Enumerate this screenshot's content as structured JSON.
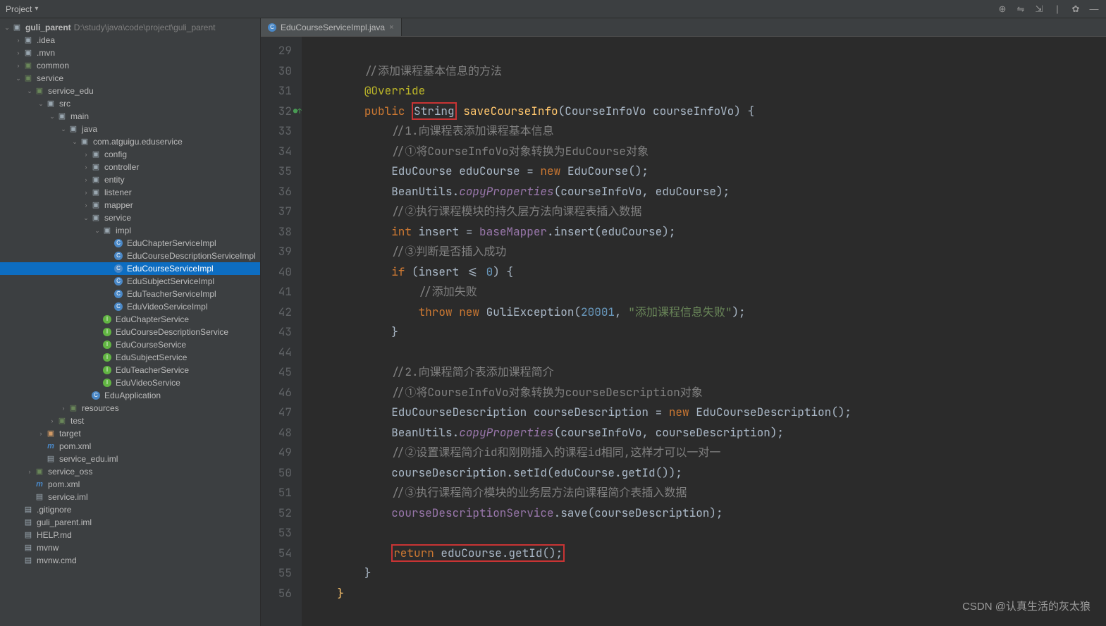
{
  "toolbar": {
    "project_label": "Project",
    "dropdown": "▾"
  },
  "project": {
    "root_name": "guli_parent",
    "root_path": "D:\\study\\java\\code\\project\\guli_parent",
    "tree": [
      {
        "label": ".idea",
        "indent": 1,
        "arrow": "closed",
        "icon": "folder"
      },
      {
        "label": ".mvn",
        "indent": 1,
        "arrow": "closed",
        "icon": "folder"
      },
      {
        "label": "common",
        "indent": 1,
        "arrow": "closed",
        "icon": "folder-green"
      },
      {
        "label": "service",
        "indent": 1,
        "arrow": "open",
        "icon": "folder-green"
      },
      {
        "label": "service_edu",
        "indent": 2,
        "arrow": "open",
        "icon": "folder-green"
      },
      {
        "label": "src",
        "indent": 3,
        "arrow": "open",
        "icon": "folder"
      },
      {
        "label": "main",
        "indent": 4,
        "arrow": "open",
        "icon": "folder"
      },
      {
        "label": "java",
        "indent": 5,
        "arrow": "open",
        "icon": "folder"
      },
      {
        "label": "com.atguigu.eduservice",
        "indent": 6,
        "arrow": "open",
        "icon": "folder"
      },
      {
        "label": "config",
        "indent": 7,
        "arrow": "closed",
        "icon": "folder"
      },
      {
        "label": "controller",
        "indent": 7,
        "arrow": "closed",
        "icon": "folder"
      },
      {
        "label": "entity",
        "indent": 7,
        "arrow": "closed",
        "icon": "folder"
      },
      {
        "label": "listener",
        "indent": 7,
        "arrow": "closed",
        "icon": "folder"
      },
      {
        "label": "mapper",
        "indent": 7,
        "arrow": "closed",
        "icon": "folder"
      },
      {
        "label": "service",
        "indent": 7,
        "arrow": "open",
        "icon": "folder"
      },
      {
        "label": "impl",
        "indent": 8,
        "arrow": "open",
        "icon": "folder"
      },
      {
        "label": "EduChapterServiceImpl",
        "indent": 9,
        "arrow": "none",
        "icon": "class"
      },
      {
        "label": "EduCourseDescriptionServiceImpl",
        "indent": 9,
        "arrow": "none",
        "icon": "class"
      },
      {
        "label": "EduCourseServiceImpl",
        "indent": 9,
        "arrow": "none",
        "icon": "class",
        "selected": true
      },
      {
        "label": "EduSubjectServiceImpl",
        "indent": 9,
        "arrow": "none",
        "icon": "class"
      },
      {
        "label": "EduTeacherServiceImpl",
        "indent": 9,
        "arrow": "none",
        "icon": "class"
      },
      {
        "label": "EduVideoServiceImpl",
        "indent": 9,
        "arrow": "none",
        "icon": "class"
      },
      {
        "label": "EduChapterService",
        "indent": 8,
        "arrow": "none",
        "icon": "interface"
      },
      {
        "label": "EduCourseDescriptionService",
        "indent": 8,
        "arrow": "none",
        "icon": "interface"
      },
      {
        "label": "EduCourseService",
        "indent": 8,
        "arrow": "none",
        "icon": "interface"
      },
      {
        "label": "EduSubjectService",
        "indent": 8,
        "arrow": "none",
        "icon": "interface"
      },
      {
        "label": "EduTeacherService",
        "indent": 8,
        "arrow": "none",
        "icon": "interface"
      },
      {
        "label": "EduVideoService",
        "indent": 8,
        "arrow": "none",
        "icon": "interface"
      },
      {
        "label": "EduApplication",
        "indent": 7,
        "arrow": "none",
        "icon": "class"
      },
      {
        "label": "resources",
        "indent": 5,
        "arrow": "closed",
        "icon": "folder-green"
      },
      {
        "label": "test",
        "indent": 4,
        "arrow": "closed",
        "icon": "folder-green"
      },
      {
        "label": "target",
        "indent": 3,
        "arrow": "closed",
        "icon": "folder-orange"
      },
      {
        "label": "pom.xml",
        "indent": 3,
        "arrow": "none",
        "icon": "maven"
      },
      {
        "label": "service_edu.iml",
        "indent": 3,
        "arrow": "none",
        "icon": "file"
      },
      {
        "label": "service_oss",
        "indent": 2,
        "arrow": "closed",
        "icon": "folder-green"
      },
      {
        "label": "pom.xml",
        "indent": 2,
        "arrow": "none",
        "icon": "maven"
      },
      {
        "label": "service.iml",
        "indent": 2,
        "arrow": "none",
        "icon": "file"
      },
      {
        "label": ".gitignore",
        "indent": 1,
        "arrow": "none",
        "icon": "file"
      },
      {
        "label": "guli_parent.iml",
        "indent": 1,
        "arrow": "none",
        "icon": "file"
      },
      {
        "label": "HELP.md",
        "indent": 1,
        "arrow": "none",
        "icon": "file"
      },
      {
        "label": "mvnw",
        "indent": 1,
        "arrow": "none",
        "icon": "file"
      },
      {
        "label": "mvnw.cmd",
        "indent": 1,
        "arrow": "none",
        "icon": "file"
      }
    ]
  },
  "tabs": {
    "current": "EduCourseServiceImpl.java"
  },
  "code": {
    "lines": [
      {
        "n": 29,
        "t": []
      },
      {
        "n": 30,
        "t": [
          {
            "s": "        "
          },
          {
            "c": "c-comment",
            "s": "//添加课程基本信息的方法"
          }
        ]
      },
      {
        "n": 31,
        "t": [
          {
            "s": "        "
          },
          {
            "c": "c-annotation",
            "s": "@Override"
          }
        ]
      },
      {
        "n": 32,
        "marker": true,
        "t": [
          {
            "s": "        "
          },
          {
            "c": "c-keyword",
            "s": "public"
          },
          {
            "s": " "
          },
          {
            "c": "c-identifier highlight-red",
            "s": "String"
          },
          {
            "s": " "
          },
          {
            "c": "c-method",
            "s": "saveCourseInfo"
          },
          {
            "c": "c-identifier",
            "s": "(CourseInfoVo courseInfoVo) {"
          }
        ]
      },
      {
        "n": 33,
        "t": [
          {
            "s": "            "
          },
          {
            "c": "c-comment",
            "s": "//1.向课程表添加课程基本信息"
          }
        ]
      },
      {
        "n": 34,
        "t": [
          {
            "s": "            "
          },
          {
            "c": "c-comment",
            "s": "//①将CourseInfoVo对象转换为EduCourse对象"
          }
        ]
      },
      {
        "n": 35,
        "t": [
          {
            "s": "            "
          },
          {
            "c": "c-identifier",
            "s": "EduCourse eduCourse = "
          },
          {
            "c": "c-keyword",
            "s": "new"
          },
          {
            "c": "c-identifier",
            "s": " EduCourse();"
          }
        ]
      },
      {
        "n": 36,
        "t": [
          {
            "s": "            "
          },
          {
            "c": "c-identifier",
            "s": "BeanUtils."
          },
          {
            "c": "c-italic",
            "s": "copyProperties"
          },
          {
            "c": "c-identifier",
            "s": "(courseInfoVo, eduCourse);"
          }
        ]
      },
      {
        "n": 37,
        "t": [
          {
            "s": "            "
          },
          {
            "c": "c-comment",
            "s": "//②执行课程模块的持久层方法向课程表插入数据"
          }
        ]
      },
      {
        "n": 38,
        "t": [
          {
            "s": "            "
          },
          {
            "c": "c-keyword",
            "s": "int"
          },
          {
            "c": "c-identifier",
            "s": " insert = "
          },
          {
            "c": "c-purple",
            "s": "baseMapper"
          },
          {
            "c": "c-identifier",
            "s": ".insert(eduCourse);"
          }
        ]
      },
      {
        "n": 39,
        "t": [
          {
            "s": "            "
          },
          {
            "c": "c-comment",
            "s": "//③判断是否插入成功"
          }
        ]
      },
      {
        "n": 40,
        "t": [
          {
            "s": "            "
          },
          {
            "c": "c-keyword",
            "s": "if"
          },
          {
            "c": "c-identifier",
            "s": " (insert <= "
          },
          {
            "c": "c-number",
            "s": "0"
          },
          {
            "c": "c-identifier",
            "s": ") {"
          }
        ]
      },
      {
        "n": 41,
        "t": [
          {
            "s": "                "
          },
          {
            "c": "c-comment",
            "s": "//添加失败"
          }
        ]
      },
      {
        "n": 42,
        "t": [
          {
            "s": "                "
          },
          {
            "c": "c-keyword",
            "s": "throw new"
          },
          {
            "c": "c-identifier",
            "s": " GuliException("
          },
          {
            "c": "c-number",
            "s": "20001"
          },
          {
            "c": "c-identifier",
            "s": ", "
          },
          {
            "c": "c-str",
            "s": "\"添加课程信息失败\""
          },
          {
            "c": "c-identifier",
            "s": ");"
          }
        ]
      },
      {
        "n": 43,
        "t": [
          {
            "s": "            "
          },
          {
            "c": "c-identifier",
            "s": "}"
          }
        ]
      },
      {
        "n": 44,
        "t": []
      },
      {
        "n": 45,
        "t": [
          {
            "s": "            "
          },
          {
            "c": "c-comment",
            "s": "//2.向课程简介表添加课程简介"
          }
        ]
      },
      {
        "n": 46,
        "t": [
          {
            "s": "            "
          },
          {
            "c": "c-comment",
            "s": "//①将CourseInfoVo对象转换为courseDescription对象"
          }
        ]
      },
      {
        "n": 47,
        "t": [
          {
            "s": "            "
          },
          {
            "c": "c-identifier",
            "s": "EduCourseDescription courseDescription = "
          },
          {
            "c": "c-keyword",
            "s": "new"
          },
          {
            "c": "c-identifier",
            "s": " EduCourseDescription();"
          }
        ]
      },
      {
        "n": 48,
        "t": [
          {
            "s": "            "
          },
          {
            "c": "c-identifier",
            "s": "BeanUtils."
          },
          {
            "c": "c-italic",
            "s": "copyProperties"
          },
          {
            "c": "c-identifier",
            "s": "(courseInfoVo, courseDescription);"
          }
        ]
      },
      {
        "n": 49,
        "t": [
          {
            "s": "            "
          },
          {
            "c": "c-comment",
            "s": "//②设置课程简介id和刚刚插入的课程id相同,这样才可以一对一"
          }
        ]
      },
      {
        "n": 50,
        "t": [
          {
            "s": "            "
          },
          {
            "c": "c-identifier",
            "s": "courseDescription.setId(eduCourse.getId());"
          }
        ]
      },
      {
        "n": 51,
        "t": [
          {
            "s": "            "
          },
          {
            "c": "c-comment",
            "s": "//③执行课程简介模块的业务层方法向课程简介表插入数据"
          }
        ]
      },
      {
        "n": 52,
        "t": [
          {
            "s": "            "
          },
          {
            "c": "c-purple",
            "s": "courseDescriptionService"
          },
          {
            "c": "c-identifier",
            "s": ".save(courseDescription);"
          }
        ]
      },
      {
        "n": 53,
        "t": []
      },
      {
        "n": 54,
        "t": [
          {
            "s": "            "
          },
          {
            "c": "highlight-red",
            "inner": [
              {
                "c": "c-keyword",
                "s": "return"
              },
              {
                "c": "c-identifier",
                "s": " eduCourse.getId();"
              }
            ]
          }
        ]
      },
      {
        "n": 55,
        "t": [
          {
            "s": "        "
          },
          {
            "c": "c-identifier",
            "s": "}"
          }
        ]
      },
      {
        "n": 56,
        "t": [
          {
            "s": "    "
          },
          {
            "c": "c-method",
            "s": "}"
          }
        ]
      }
    ]
  },
  "watermark": "CSDN @认真生活的灰太狼"
}
